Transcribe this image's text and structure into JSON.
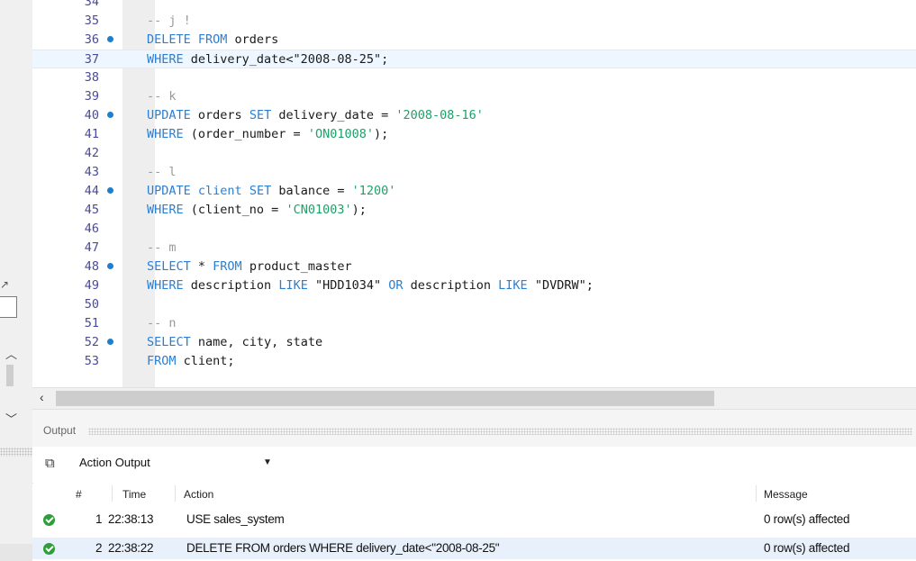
{
  "editor": {
    "lines": [
      {
        "num": "34",
        "bp": false,
        "segs": []
      },
      {
        "num": "35",
        "bp": false,
        "segs": [
          {
            "t": "-- j !",
            "c": "cm"
          }
        ]
      },
      {
        "num": "36",
        "bp": true,
        "segs": [
          {
            "t": "DELETE FROM",
            "c": "kw"
          },
          {
            "t": " orders",
            "c": "tx"
          }
        ]
      },
      {
        "num": "37",
        "bp": false,
        "current": true,
        "segs": [
          {
            "t": "WHERE",
            "c": "kw"
          },
          {
            "t": " delivery_date<\"2008-08-25\";",
            "c": "tx"
          }
        ]
      },
      {
        "num": "38",
        "bp": false,
        "segs": []
      },
      {
        "num": "39",
        "bp": false,
        "segs": [
          {
            "t": "-- k",
            "c": "cm"
          }
        ]
      },
      {
        "num": "40",
        "bp": true,
        "segs": [
          {
            "t": "UPDATE",
            "c": "kw"
          },
          {
            "t": " orders ",
            "c": "tx"
          },
          {
            "t": "SET",
            "c": "kw"
          },
          {
            "t": " delivery_date = ",
            "c": "tx"
          },
          {
            "t": "'2008-08-16'",
            "c": "st"
          }
        ]
      },
      {
        "num": "41",
        "bp": false,
        "segs": [
          {
            "t": "WHERE",
            "c": "kw"
          },
          {
            "t": " (order_number = ",
            "c": "tx"
          },
          {
            "t": "'ON01008'",
            "c": "st"
          },
          {
            "t": ");",
            "c": "tx"
          }
        ]
      },
      {
        "num": "42",
        "bp": false,
        "segs": []
      },
      {
        "num": "43",
        "bp": false,
        "segs": [
          {
            "t": "-- l",
            "c": "cm"
          }
        ]
      },
      {
        "num": "44",
        "bp": true,
        "segs": [
          {
            "t": "UPDATE",
            "c": "kw"
          },
          {
            "t": " ",
            "c": "tx"
          },
          {
            "t": "client",
            "c": "kw"
          },
          {
            "t": " ",
            "c": "tx"
          },
          {
            "t": "SET",
            "c": "kw"
          },
          {
            "t": " balance = ",
            "c": "tx"
          },
          {
            "t": "'1200'",
            "c": "st"
          }
        ]
      },
      {
        "num": "45",
        "bp": false,
        "segs": [
          {
            "t": "WHERE",
            "c": "kw"
          },
          {
            "t": " (client_no = ",
            "c": "tx"
          },
          {
            "t": "'CN01003'",
            "c": "st"
          },
          {
            "t": ");",
            "c": "tx"
          }
        ]
      },
      {
        "num": "46",
        "bp": false,
        "segs": []
      },
      {
        "num": "47",
        "bp": false,
        "segs": [
          {
            "t": "-- m",
            "c": "cm"
          }
        ]
      },
      {
        "num": "48",
        "bp": true,
        "segs": [
          {
            "t": "SELECT",
            "c": "kw"
          },
          {
            "t": " * ",
            "c": "tx"
          },
          {
            "t": "FROM",
            "c": "kw"
          },
          {
            "t": " product_master",
            "c": "tx"
          }
        ]
      },
      {
        "num": "49",
        "bp": false,
        "segs": [
          {
            "t": "WHERE",
            "c": "kw"
          },
          {
            "t": " description ",
            "c": "tx"
          },
          {
            "t": "LIKE",
            "c": "kw"
          },
          {
            "t": " \"HDD1034\" ",
            "c": "tx"
          },
          {
            "t": "OR",
            "c": "kw"
          },
          {
            "t": " description ",
            "c": "tx"
          },
          {
            "t": "LIKE",
            "c": "kw"
          },
          {
            "t": " \"DVDRW\";",
            "c": "tx"
          }
        ]
      },
      {
        "num": "50",
        "bp": false,
        "segs": []
      },
      {
        "num": "51",
        "bp": false,
        "segs": [
          {
            "t": "-- n",
            "c": "cm"
          }
        ]
      },
      {
        "num": "52",
        "bp": true,
        "segs": [
          {
            "t": "SELECT",
            "c": "kw"
          },
          {
            "t": " name, city, state",
            "c": "tx"
          }
        ]
      },
      {
        "num": "53",
        "bp": false,
        "segs": [
          {
            "t": "FROM",
            "c": "kw"
          },
          {
            "t": " client;",
            "c": "tx"
          }
        ]
      }
    ]
  },
  "output": {
    "title": "Output",
    "mode_label": "Action Output",
    "columns": {
      "num": "#",
      "time": "Time",
      "action": "Action",
      "message": "Message"
    },
    "rows": [
      {
        "num": "1",
        "time": "22:38:13",
        "action": "USE sales_system",
        "message": "0 row(s) affected",
        "selected": false
      },
      {
        "num": "2",
        "time": "22:38:22",
        "action": "DELETE FROM orders  WHERE delivery_date<\"2008-08-25\"",
        "message": "0 row(s) affected",
        "selected": true
      }
    ]
  },
  "icons": {
    "breakpoint": "breakpoint-dot-icon",
    "success": "check-circle-icon",
    "copy": "copy-icon",
    "dropdown": "chevron-down-icon"
  },
  "colors": {
    "keyword": "#2a7fd4",
    "string": "#1ea06a",
    "comment": "#999999",
    "breakpoint": "#1e7fd0",
    "success": "#2e9e3a"
  }
}
